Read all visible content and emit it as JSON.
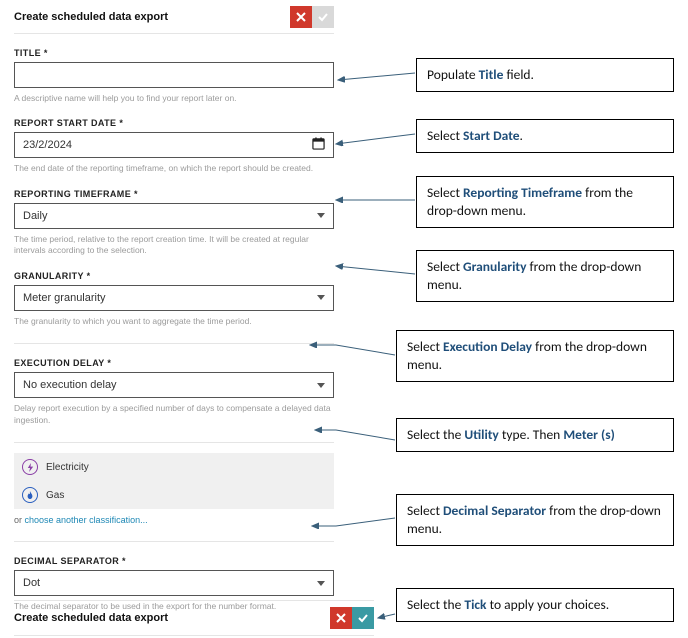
{
  "header": {
    "title": "Create scheduled data export"
  },
  "form": {
    "title": {
      "label": "TITLE *",
      "value": "",
      "helper": "A descriptive name will help you to find your report later on."
    },
    "start_date": {
      "label": "REPORT START DATE *",
      "value": "23/2/2024",
      "helper": "The end date of the reporting timeframe, on which the report should be created."
    },
    "timeframe": {
      "label": "REPORTING TIMEFRAME *",
      "value": "Daily",
      "helper": "The time period, relative to the report creation time. It will be created at regular intervals according to the selection."
    },
    "granularity": {
      "label": "GRANULARITY *",
      "value": "Meter granularity",
      "helper": "The granularity to which you want to aggregate the time period."
    },
    "execution_delay": {
      "label": "EXECUTION DELAY *",
      "value": "No execution delay",
      "helper": "Delay report execution by a specified number of days to compensate a delayed data ingestion."
    },
    "utilities": {
      "items": [
        {
          "name": "Electricity"
        },
        {
          "name": "Gas"
        }
      ],
      "or_text": "or ",
      "choose_link": "choose another classification..."
    },
    "decimal": {
      "label": "DECIMAL SEPARATOR *",
      "value": "Dot",
      "helper": "The decimal separator to be used in the export for the number format."
    }
  },
  "bottom": {
    "title": "Create scheduled data export"
  },
  "callouts": {
    "c1": {
      "pre": "Populate ",
      "kw": "Title",
      "post": " field."
    },
    "c2": {
      "pre": "Select ",
      "kw": "Start Date",
      "post": "."
    },
    "c3": {
      "pre": "Select ",
      "kw": "Reporting Timeframe",
      "post": " from the drop-down menu."
    },
    "c4": {
      "pre": "Select ",
      "kw": "Granularity",
      "post": " from the drop-down menu."
    },
    "c5": {
      "pre": "Select ",
      "kw": "Execution Delay",
      "post": " from the drop-down menu."
    },
    "c6": {
      "pre": "Select the ",
      "kw": "Utility",
      "mid": " type. Then ",
      "kw2": "Meter (s)"
    },
    "c7": {
      "pre": "Select ",
      "kw": "Decimal Separator",
      "post": " from the drop-down menu."
    },
    "c8": {
      "pre": "Select the ",
      "kw": "Tick",
      "post": " to apply your choices."
    }
  }
}
